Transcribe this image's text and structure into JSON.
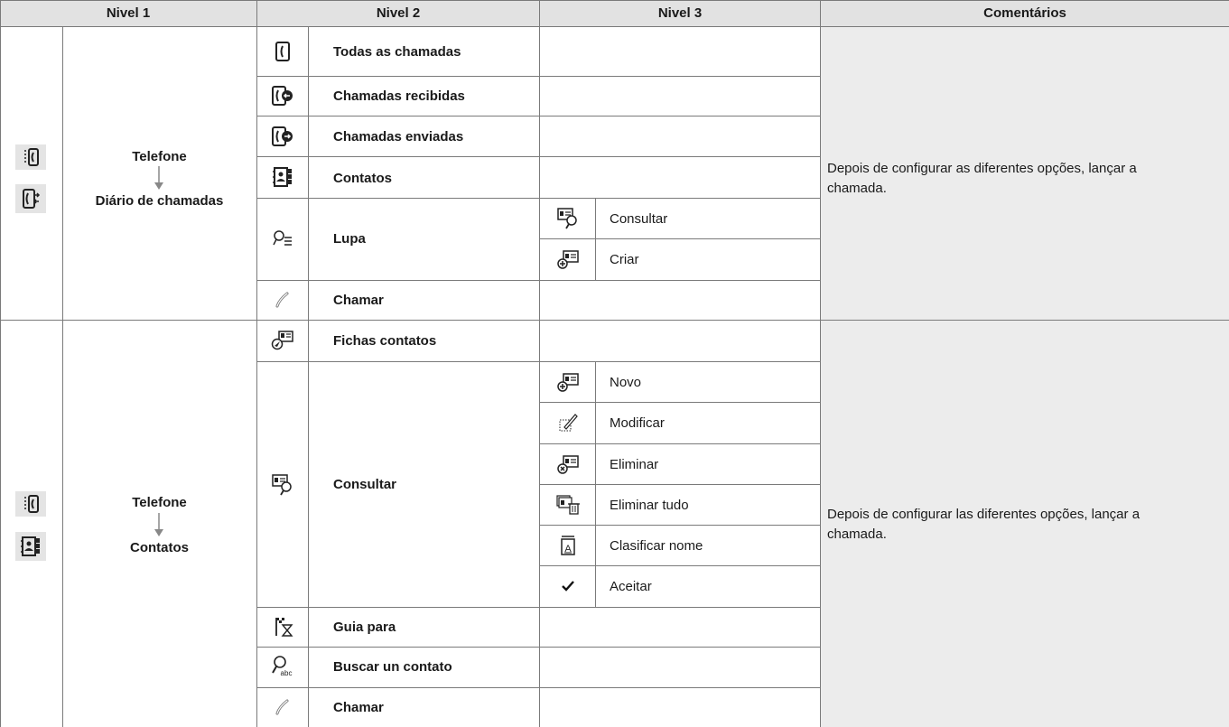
{
  "headers": {
    "nivel1": "Nivel 1",
    "nivel2": "Nivel 2",
    "nivel3": "Nivel 3",
    "comentarios": "Comentários"
  },
  "section1": {
    "level1_top": "Telefone",
    "level1_bottom": "Diário de chamadas",
    "level1_icons": [
      "phone-menu-icon",
      "call-log-icon"
    ],
    "rows": [
      {
        "icon": "all-calls-icon",
        "label": "Todas as chamadas"
      },
      {
        "icon": "received-calls-icon",
        "label": "Chamadas recibidas"
      },
      {
        "icon": "sent-calls-icon",
        "label": "Chamadas enviadas"
      },
      {
        "icon": "contacts-book-icon",
        "label": "Contatos"
      },
      {
        "icon": "magnifier-list-icon",
        "label": "Lupa",
        "sub": [
          {
            "icon": "consult-card-icon",
            "label": "Consultar"
          },
          {
            "icon": "create-card-icon",
            "label": "Criar"
          }
        ]
      },
      {
        "icon": "handset-icon",
        "label": "Chamar"
      }
    ],
    "comment": "Depois de configurar as diferentes opções, lançar a chamada."
  },
  "section2": {
    "level1_top": "Telefone",
    "level1_bottom": "Contatos",
    "level1_icons": [
      "phone-menu-icon",
      "contacts-book-icon"
    ],
    "rows": [
      {
        "icon": "contact-cards-icon",
        "label": "Fichas contatos"
      },
      {
        "icon": "consult-card-icon",
        "label": "Consultar",
        "sub": [
          {
            "icon": "new-card-icon",
            "label": "Novo"
          },
          {
            "icon": "edit-pencil-icon",
            "label": "Modificar"
          },
          {
            "icon": "delete-card-icon",
            "label": "Eliminar"
          },
          {
            "icon": "delete-all-icon",
            "label": "Eliminar tudo"
          },
          {
            "icon": "sort-name-icon",
            "label": "Clasificar nome"
          },
          {
            "icon": "checkmark-icon",
            "label": "Aceitar"
          }
        ]
      },
      {
        "icon": "guide-flag-icon",
        "label": "Guia para"
      },
      {
        "icon": "search-abc-icon",
        "label": "Buscar un contato"
      },
      {
        "icon": "handset-icon",
        "label": "Chamar"
      }
    ],
    "comment": "Depois de configurar las diferentes opções, lançar a chamada."
  }
}
